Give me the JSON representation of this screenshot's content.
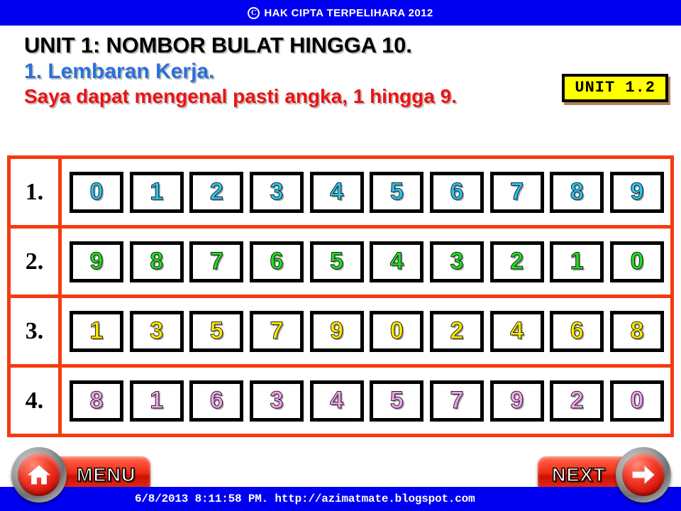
{
  "banner": {
    "copyright_symbol": "C",
    "text": "HAK CIPTA TERPELIHARA 2012",
    "background_color": "#0000f0",
    "text_color": "#ffffff"
  },
  "heading": {
    "title_main": "UNIT 1: NOMBOR BULAT  HINGGA 10.",
    "title_sub": "1. Lembaran Kerja.",
    "objective": "Saya dapat mengenal pasti angka, 1 hingga 9.",
    "title_main_color": "#000000",
    "title_sub_color": "#2a6fdb",
    "objective_color": "#ee1111"
  },
  "unit_badge": {
    "label": "UNIT 1.2",
    "background_color": "#ffff00",
    "border_color": "#000000"
  },
  "worksheet": {
    "border_color": "#f63a10",
    "box_border_color": "#000000",
    "rows": [
      {
        "number": "1.",
        "digit_color": "#29c5f0",
        "digits": [
          "0",
          "1",
          "2",
          "3",
          "4",
          "5",
          "6",
          "7",
          "8",
          "9"
        ]
      },
      {
        "number": "2.",
        "digit_color": "#22dd22",
        "digits": [
          "9",
          "8",
          "7",
          "6",
          "5",
          "4",
          "3",
          "2",
          "1",
          "0"
        ]
      },
      {
        "number": "3.",
        "digit_color": "#ffe800",
        "digits": [
          "1",
          "3",
          "5",
          "7",
          "9",
          "0",
          "2",
          "4",
          "6",
          "8"
        ]
      },
      {
        "number": "4.",
        "digit_color": "#f5a0ee",
        "digits": [
          "8",
          "1",
          "6",
          "3",
          "4",
          "5",
          "7",
          "9",
          "2",
          "0"
        ]
      }
    ]
  },
  "nav": {
    "menu_label": "MENU",
    "next_label": "NEXT",
    "menu_icon": "home-icon",
    "next_icon": "arrow-right-icon",
    "button_color": "#ee2a10"
  },
  "footer": {
    "text": "6/8/2013 8:11:58 PM. http://azimatmate.blogspot.com",
    "background_color": "#0000f0",
    "text_color": "#ffffff"
  }
}
